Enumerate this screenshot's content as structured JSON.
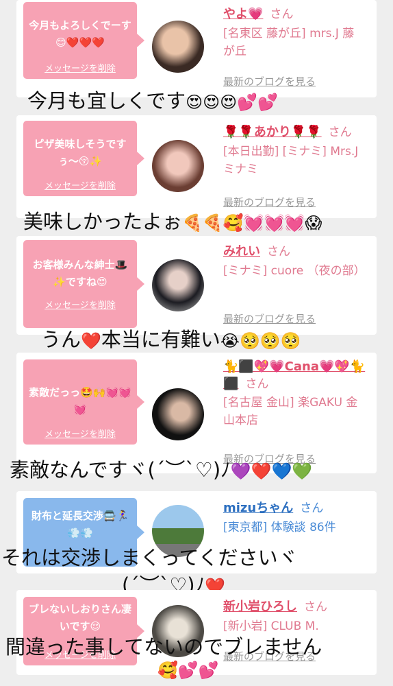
{
  "delete_label": "メッセージを削除",
  "blog_label": "最新のブログを見る",
  "san_label": "さん",
  "cards": [
    {
      "message": "今月もよろしくでーす😊❤️❤️❤️",
      "name": "やよ💗",
      "shop": "[名東区 藤が丘] mrs.J 藤が丘",
      "color": "pink"
    },
    {
      "message": "ピザ美味しそうですぅ〜😚✨",
      "name": "🌹🌹あかり🌹🌹",
      "shop": "[本日出勤] [ミナミ] Mrs.J ミナミ",
      "color": "pink"
    },
    {
      "message": "お客様みんな紳士🎩✨ですね😍",
      "name": "みれい",
      "shop": "[ミナミ] cuore （夜の部）",
      "color": "pink"
    },
    {
      "message": "素敵だっっ🤩🙌💓💓💓",
      "name": "🐈⬛💖💗Cana💗💖🐈⬛",
      "shop": "[名古屋 金山] 楽GAKU 金山本店",
      "color": "pink"
    },
    {
      "message": "財布と延長交渉🚍🏃‍♀️💨💨",
      "name": "mizuちゃん",
      "shop": "[東京都] 体験談 86件",
      "color": "blue"
    },
    {
      "message": "ブレないしおりさん凄いです😌",
      "name": "新小岩ひろし",
      "shop": "[新小岩] CLUB M.",
      "color": "pink"
    }
  ],
  "replies": [
    {
      "text": "今月も宜しくです",
      "emoji": "😍😍😍💕💕"
    },
    {
      "text": "美味しかったよぉ",
      "emoji": "🍕🍕🥰💓💓💓😱"
    },
    {
      "text": "うん",
      "mid_emoji": "❤️",
      "text2": "本当に有難い",
      "emoji": "😭🥺🥺🥺"
    },
    {
      "text": "素敵なんですヾ(´︶`♡)ﾉ",
      "emoji": "💜❤️💙💚"
    },
    {
      "text": "それは交渉しまくってくださいヾ",
      "text2": "(´︶`♡)ﾉ",
      "emoji": "❤️"
    },
    {
      "text": "間違った事してないのでブレません",
      "emoji": "🥰💕💕"
    }
  ]
}
